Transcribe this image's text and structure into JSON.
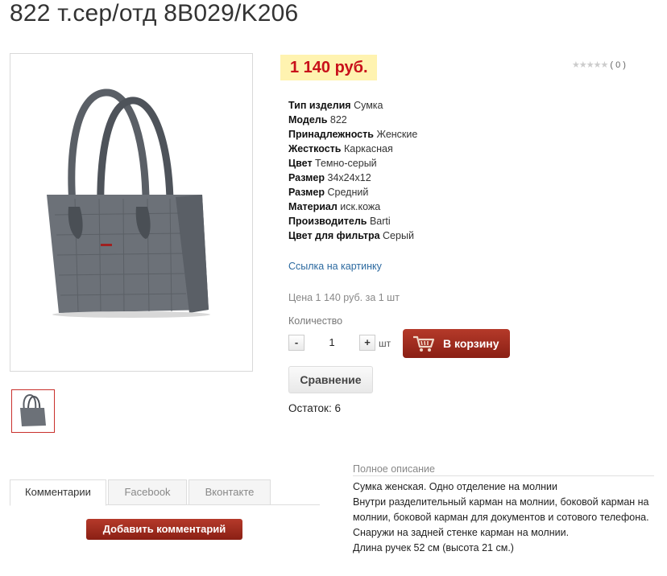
{
  "page": {
    "title": "822 т.сер/отд 8B029/K206"
  },
  "product": {
    "price": "1 140 руб.",
    "rating": {
      "stars": "★★★★★",
      "count": "( 0 )",
      "value": 0
    },
    "specs": [
      {
        "label": "Тип изделия",
        "value": "Сумка"
      },
      {
        "label": "Модель",
        "value": "822"
      },
      {
        "label": "Принадлежность",
        "value": "Женские"
      },
      {
        "label": "Жесткость",
        "value": "Каркасная"
      },
      {
        "label": "Цвет",
        "value": "Темно-серый"
      },
      {
        "label": "Размер",
        "value": "34х24х12"
      },
      {
        "label": "Размер",
        "value": "Средний"
      },
      {
        "label": "Материал",
        "value": "иск.кожа"
      },
      {
        "label": "Производитель",
        "value": "Barti"
      },
      {
        "label": "Цвет для фильтра",
        "value": "Серый"
      }
    ],
    "picture_link": "Ссылка на картинку",
    "price_note": "Цена 1 140 руб. за 1 шт",
    "quantity": {
      "label": "Количество",
      "minus": "-",
      "value": "1",
      "plus": "+",
      "unit": "шт"
    },
    "cart_button": "В корзину",
    "compare_button": "Сравнение",
    "stock": "Остаток: 6"
  },
  "tabs": [
    {
      "label": "Комментарии",
      "active": true
    },
    {
      "label": "Facebook",
      "active": false
    },
    {
      "label": "Вконтакте",
      "active": false
    }
  ],
  "add_comment_button": "Добавить комментарий",
  "description": {
    "heading": "Полное описание",
    "lines": [
      "Сумка женская. Одно отделение на молнии",
      "Внутри разделительный карман на молнии, боковой карман на молнии, боковой карман для документов и сотового телефона.",
      "Снаружи на задней стенке карман на молнии.",
      "Длина ручек 52 см (высота 21 см.)"
    ]
  },
  "colors": {
    "price_red": "#c8101a",
    "price_bg": "#fff3b0",
    "button_red": "#8a1f14",
    "link_blue": "#2c6aa0"
  }
}
